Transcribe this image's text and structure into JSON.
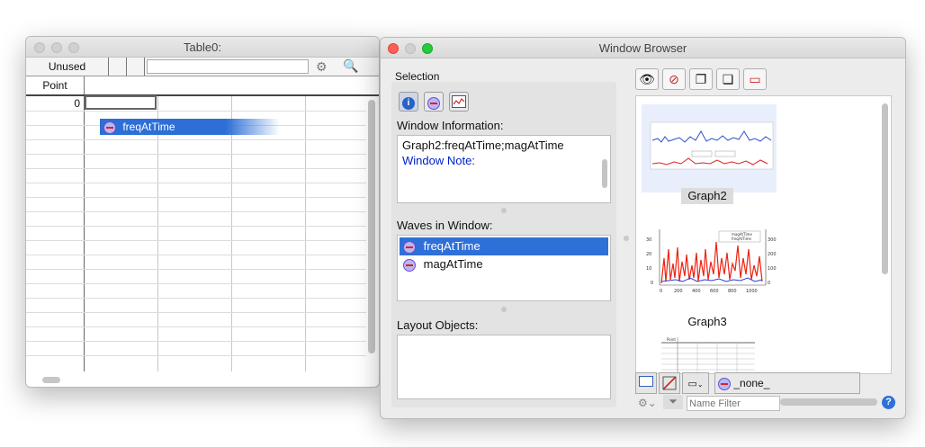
{
  "table_window": {
    "title": "Table0:",
    "unused_label": "Unused",
    "column_header": "Point",
    "first_row_index": "0",
    "dragged_item": "freqAtTime",
    "icons": [
      "gear-icon",
      "inspect-icon"
    ]
  },
  "browser_window": {
    "title": "Window Browser",
    "selection_label": "Selection",
    "window_info_label": "Window Information:",
    "window_info_line1": "Graph2:freqAtTime;magAtTime",
    "window_note_label": "Window Note:",
    "waves_label": "Waves in Window:",
    "waves": [
      "freqAtTime",
      "magAtTime"
    ],
    "selected_wave": "freqAtTime",
    "layout_objects_label": "Layout Objects:",
    "thumbnails": [
      "Graph2",
      "Graph3"
    ],
    "graph3_legend": [
      "magAtTime",
      "freqAtTime"
    ],
    "graph3_left_ticks": [
      "30",
      "20",
      "10",
      "0"
    ],
    "graph3_right_ticks": [
      "300",
      "200",
      "100",
      "0"
    ],
    "graph3_x_ticks": [
      "0",
      "200",
      "400",
      "600",
      "800",
      "1000"
    ],
    "graph4_header": "Point",
    "none_label": "_none_",
    "name_filter_placeholder": "Name Filter",
    "help_label": "?",
    "accent_color": "#2f6fd8",
    "note_color": "#0020c8"
  }
}
